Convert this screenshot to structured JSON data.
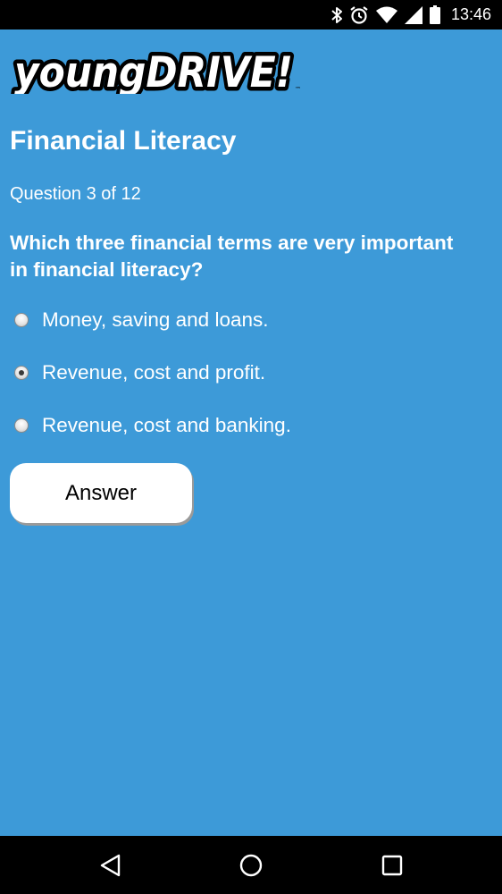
{
  "status_bar": {
    "time": "13:46",
    "icons": [
      "bluetooth-icon",
      "alarm-icon",
      "wifi-icon",
      "cell-signal-icon",
      "battery-icon"
    ]
  },
  "logo": {
    "text": "youngDRIVE!",
    "trademark": "™"
  },
  "screen": {
    "title": "Financial Literacy",
    "progress": "Question 3 of 12",
    "question": "Which three financial terms are very important in financial literacy?"
  },
  "options": [
    {
      "label": "Money, saving and loans.",
      "selected": false
    },
    {
      "label": "Revenue, cost and profit.",
      "selected": true
    },
    {
      "label": "Revenue, cost and banking.",
      "selected": false
    }
  ],
  "answer_button": {
    "label": "Answer"
  },
  "nav_bar": {
    "icons": [
      "back-icon",
      "home-icon",
      "recents-icon"
    ]
  },
  "colors": {
    "background": "#3d9ad8",
    "text": "#ffffff",
    "button_bg": "#ffffff",
    "bars": "#000000"
  }
}
